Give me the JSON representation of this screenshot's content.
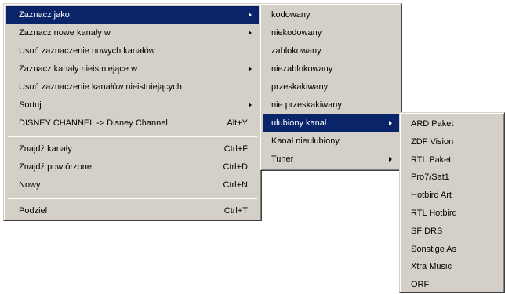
{
  "main_menu": {
    "items": [
      {
        "label": "Zaznacz jako",
        "shortcut": "",
        "submenu": true,
        "highlighted": true
      },
      {
        "label": "Zaznacz nowe kanały w",
        "shortcut": "",
        "submenu": true
      },
      {
        "label": "Usuń zaznaczenie nowych kanałów",
        "shortcut": "",
        "submenu": false
      },
      {
        "label": "Zaznacz kanały nieistniejące w",
        "shortcut": "",
        "submenu": true
      },
      {
        "label": "Usuń zaznaczenie kanałów nieistniejących",
        "shortcut": "",
        "submenu": false
      },
      {
        "label": "Sortuj",
        "shortcut": "",
        "submenu": true
      },
      {
        "label": "DISNEY CHANNEL -> Disney Channel",
        "shortcut": "Alt+Y",
        "submenu": false
      },
      {
        "label": "Znajdź kanały",
        "shortcut": "Ctrl+F",
        "submenu": false
      },
      {
        "label": "Znajdź powtórzone",
        "shortcut": "Ctrl+D",
        "submenu": false
      },
      {
        "label": "Nowy",
        "shortcut": "Ctrl+N",
        "submenu": false
      },
      {
        "label": "Podziel",
        "shortcut": "Ctrl+T",
        "submenu": false
      }
    ]
  },
  "mark_as_menu": {
    "items": [
      {
        "label": "kodowany",
        "submenu": false
      },
      {
        "label": "niekodowany",
        "submenu": false
      },
      {
        "label": "zablokowany",
        "submenu": false
      },
      {
        "label": "niezablokowany",
        "submenu": false
      },
      {
        "label": "przeskakiwany",
        "submenu": false
      },
      {
        "label": "nie przeskakiwany",
        "submenu": false
      },
      {
        "label": "ulubiony kanał",
        "submenu": true,
        "highlighted": true
      },
      {
        "label": "Kanał nieulubiony",
        "submenu": false
      },
      {
        "label": "Tuner",
        "submenu": true
      }
    ]
  },
  "favorites_menu": {
    "items": [
      {
        "label": "ARD Paket"
      },
      {
        "label": "ZDF Vision"
      },
      {
        "label": "RTL Paket"
      },
      {
        "label": "Pro7/Sat1"
      },
      {
        "label": "Hotbird Art"
      },
      {
        "label": "RTL Hotbird"
      },
      {
        "label": "SF DRS"
      },
      {
        "label": "Sonstige As"
      },
      {
        "label": "Xtra Music"
      },
      {
        "label": "ORF"
      }
    ]
  },
  "colors": {
    "menu_background": "#d4d0c8",
    "highlight": "#0a246a",
    "highlight_text": "#ffffff"
  }
}
